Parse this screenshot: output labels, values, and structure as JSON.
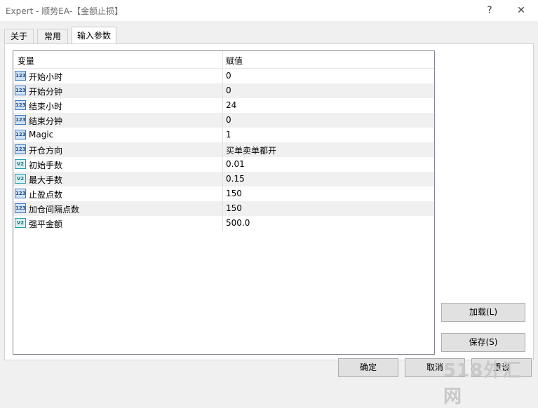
{
  "window": {
    "title": "Expert - 顺势EA-【金额止损】",
    "help_glyph": "?",
    "close_glyph": "✕"
  },
  "tabs": [
    {
      "label": "关于"
    },
    {
      "label": "常用"
    },
    {
      "label": "输入参数"
    }
  ],
  "grid": {
    "col_variable": "变量",
    "col_value": "赋值",
    "rows": [
      {
        "name": "开始小时",
        "value": "0",
        "icon": "int-icon",
        "icon_text": "123"
      },
      {
        "name": "开始分钟",
        "value": "0",
        "icon": "int-icon",
        "icon_text": "123"
      },
      {
        "name": "结束小时",
        "value": "24",
        "icon": "int-icon",
        "icon_text": "123"
      },
      {
        "name": "结束分钟",
        "value": "0",
        "icon": "int-icon",
        "icon_text": "123"
      },
      {
        "name": "Magic",
        "value": "1",
        "icon": "int-icon",
        "icon_text": "123"
      },
      {
        "name": "开仓方向",
        "value": "买单卖单都开",
        "icon": "int-icon",
        "icon_text": "123"
      },
      {
        "name": "初始手数",
        "value": "0.01",
        "icon": "double-icon",
        "icon_text": "V2"
      },
      {
        "name": "最大手数",
        "value": "0.15",
        "icon": "double-icon",
        "icon_text": "V2"
      },
      {
        "name": "止盈点数",
        "value": "150",
        "icon": "int-icon",
        "icon_text": "123"
      },
      {
        "name": "加仓间隔点数",
        "value": "150",
        "icon": "int-icon",
        "icon_text": "123"
      },
      {
        "name": "强平金额",
        "value": "500.0",
        "icon": "double-icon",
        "icon_text": "V2"
      }
    ]
  },
  "buttons": {
    "load": "加载(L)",
    "save": "保存(S)",
    "ok": "确定",
    "cancel": "取消",
    "reset": "重设"
  },
  "watermark": "518外汇网"
}
